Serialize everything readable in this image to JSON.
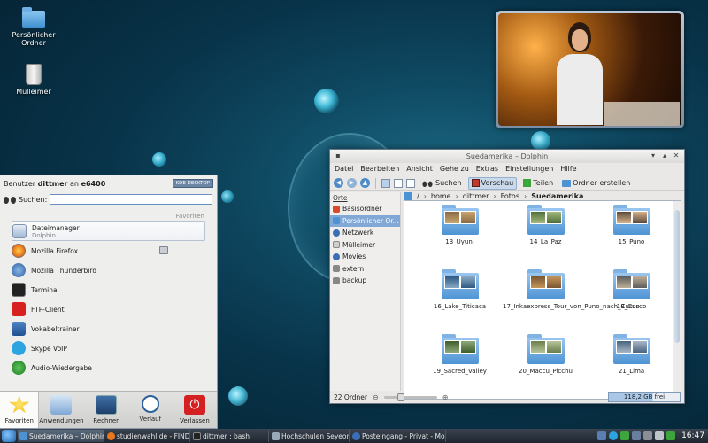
{
  "desktop": {
    "icons": [
      {
        "label": "Persönlicher Ordner"
      },
      {
        "label": "Mülleimer"
      }
    ]
  },
  "dolphin": {
    "title": "Suedamerika – Dolphin",
    "menu": [
      "Datei",
      "Bearbeiten",
      "Ansicht",
      "Gehe zu",
      "Extras",
      "Einstellungen",
      "Hilfe"
    ],
    "toolbar": {
      "search": "Suchen",
      "preview": "Vorschau",
      "share": "Teilen",
      "new_folder": "Ordner erstellen"
    },
    "places": {
      "header": "Orte",
      "items": [
        "Basisordner",
        "Persönlicher Or...",
        "Netzwerk",
        "Mülleimer",
        "Movies",
        "extern",
        "backup"
      ]
    },
    "breadcrumb": {
      "root": "/",
      "parts": [
        "home",
        "dittmer",
        "Fotos",
        "Suedamerika"
      ]
    },
    "files": [
      "13_Uyuni",
      "14_La_Paz",
      "15_Puno",
      "16_Lake_Titicaca",
      "17_Inkaexpress_Tour_von_Puno_nach_Cusco",
      "18_Cusco",
      "19_Sacred_Valley",
      "20_Maccu_Picchu",
      "21_Lima"
    ],
    "status": {
      "count": "22 Ordner",
      "free": "118,2 GB frei",
      "free_used_fraction": 0.62,
      "zoom_fraction": 0.3
    }
  },
  "kickoff": {
    "user_prefix": "Benutzer",
    "user": "dittmer",
    "user_mid": "an",
    "host": "e6400",
    "logo_text": "KDE DESKTOP",
    "search_label": "Suchen:",
    "section": "Favoriten",
    "items": [
      {
        "name": "Dateimanager",
        "sub": "Dolphin"
      },
      {
        "name": "Mozilla Firefox",
        "sub": ""
      },
      {
        "name": "Mozilla Thunderbird",
        "sub": ""
      },
      {
        "name": "Terminal",
        "sub": ""
      },
      {
        "name": "FTP-Client",
        "sub": ""
      },
      {
        "name": "Vokabeltrainer",
        "sub": ""
      },
      {
        "name": "Skype VoIP",
        "sub": ""
      },
      {
        "name": "Audio-Wiedergabe",
        "sub": ""
      }
    ],
    "tabs": [
      "Favoriten",
      "Anwendungen",
      "Rechner",
      "Verlauf",
      "Verlassen"
    ]
  },
  "taskbar": {
    "tasks": [
      "Suedamerika – Dolphin",
      "studienwahl.de - FINDE",
      "dittmer : bash",
      "Hochschulen Seyeong",
      "Posteingang - Privat - Mo"
    ],
    "clock": "16:47"
  },
  "colors": {
    "accent": "#82a8d6",
    "folder": "#4d93d4",
    "ftp_red": "#d6211e",
    "logout_red": "#d42020"
  }
}
